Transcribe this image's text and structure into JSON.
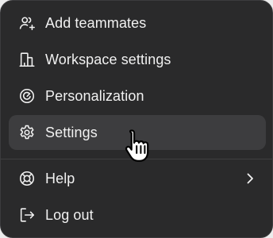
{
  "menu": {
    "items": [
      {
        "label": "Add teammates",
        "icon": "add-teammates-icon"
      },
      {
        "label": "Workspace settings",
        "icon": "workspace-building-icon"
      },
      {
        "label": "Personalization",
        "icon": "personalization-icon"
      },
      {
        "label": "Settings",
        "icon": "gear-icon",
        "state": "hovered"
      },
      {
        "label": "Help",
        "icon": "lifebuoy-icon",
        "submenu": true
      },
      {
        "label": "Log out",
        "icon": "logout-icon"
      }
    ]
  },
  "colors": {
    "menu_background": "#2a2a2b",
    "hover_background": "#3d3d3f",
    "text": "#f1f1f1"
  },
  "cursor": {
    "icon": "hand-pointer-icon"
  }
}
